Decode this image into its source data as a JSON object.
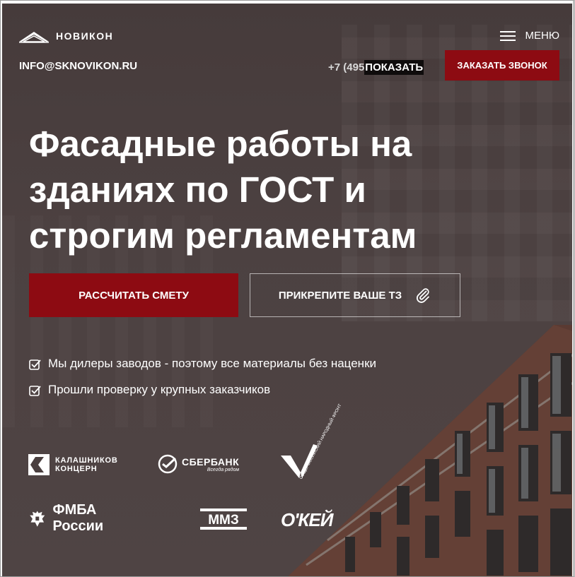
{
  "header": {
    "logo_text": "НОВИКОН",
    "menu_label": "МЕНЮ",
    "email": "INFO@SKNOVIKON.RU",
    "phone_partial": "+7 (495",
    "phone_show_label": "ПОКАЗАТЬ",
    "call_button_label": "ЗАКАЗАТЬ ЗВОНОК"
  },
  "hero": {
    "headline_line1": "Фасадные работы на",
    "headline_line2": "зданиях по ГОСТ и",
    "headline_line3": "строгим регламентам",
    "primary_button_label": "РАССЧИТАТЬ СМЕТУ",
    "attach_button_label": "ПРИКРЕПИТЕ ВАШЕ ТЗ"
  },
  "features": [
    {
      "text": "Мы дилеры заводов - поэтому все материалы без наценки"
    },
    {
      "text": "Прошли проверку у крупных заказчиков"
    }
  ],
  "clients": {
    "kalashnikov_line1": "КАЛАШНИКОВ",
    "kalashnikov_line2": "КОНЦЕРН",
    "sberbank": "СБЕРБАНК",
    "sberbank_tagline": "Всегда рядом",
    "onf_text": "ОБЩЕРОССИЙСКИЙ НАРОДНЫЙ ФРОНТ",
    "fmba": "ФМБА России",
    "mmz": "ММЗ",
    "okey": "О'КЕЙ"
  },
  "colors": {
    "accent": "#8d0b12",
    "background": "#4a3f3f",
    "text": "#ffffff"
  },
  "icons": [
    "logo-icon",
    "hamburger-icon",
    "paperclip-icon",
    "checkbox-icon"
  ]
}
